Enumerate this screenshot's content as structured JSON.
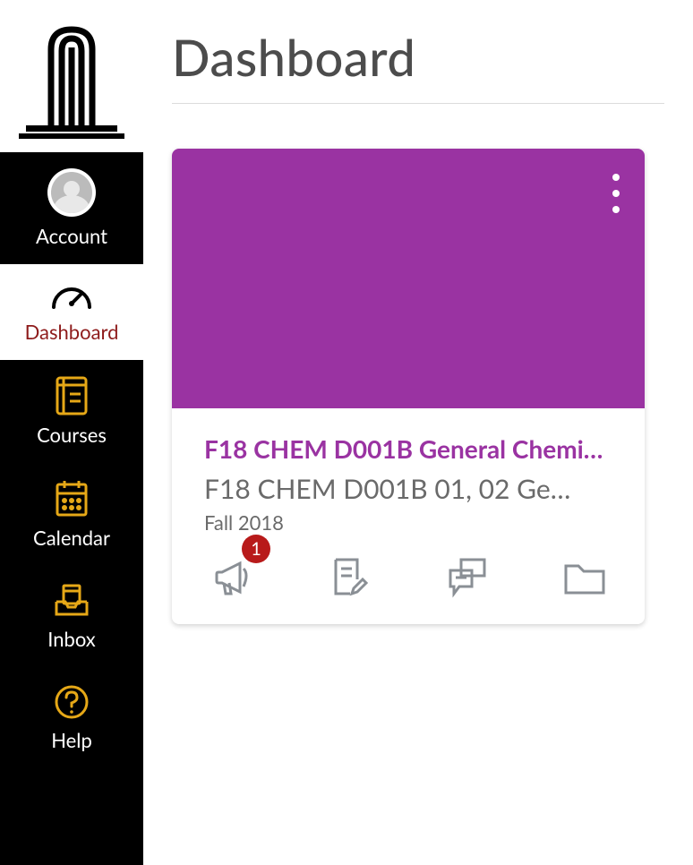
{
  "page": {
    "title": "Dashboard"
  },
  "nav": {
    "account": "Account",
    "dashboard": "Dashboard",
    "courses": "Courses",
    "calendar": "Calendar",
    "inbox": "Inbox",
    "help": "Help"
  },
  "course_card": {
    "title": "F18 CHEM D001B General Chemi…",
    "subtitle": "F18 CHEM D001B 01, 02 Ge…",
    "term": "Fall 2018",
    "banner_color": "#9a33a2",
    "announcements_badge": "1"
  }
}
